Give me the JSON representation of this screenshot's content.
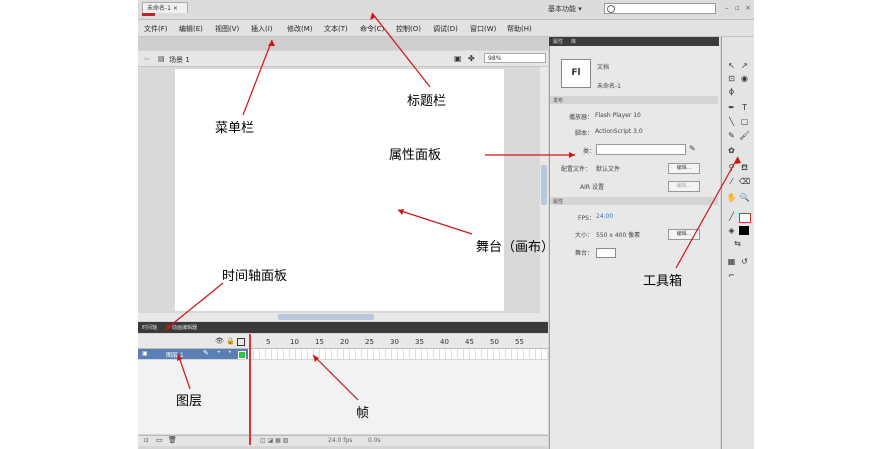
{
  "window": {
    "app_logo": "Fl",
    "workspace": "基本功能",
    "search_placeholder": ""
  },
  "menu": [
    "文件(F)",
    "编辑(E)",
    "视图(V)",
    "插入(I)",
    "修改(M)",
    "文本(T)",
    "命令(C)",
    "控制(O)",
    "调试(D)",
    "窗口(W)",
    "帮助(H)"
  ],
  "document": {
    "tab_label": "未命名-1",
    "scene_label": "场景 1",
    "zoom": "98%"
  },
  "timeline": {
    "tabs": [
      "时间轴",
      "动画编辑器"
    ],
    "frame_numbers": [
      "5",
      "10",
      "15",
      "20",
      "25",
      "30",
      "35",
      "40",
      "45",
      "50",
      "55"
    ],
    "layer_name": "图层 1",
    "footer_fps": "24.0 fps",
    "footer_time": "0.0s"
  },
  "properties": {
    "tabs": [
      "属性",
      "库"
    ],
    "doc_type": "文档",
    "doc_name": "未命名-1",
    "publish_section": "发布",
    "player_label": "播放器：",
    "player_value": "Flash Player 10",
    "script_label": "脚本：",
    "script_value": "ActionScript 3.0",
    "class_label": "类：",
    "profile_label": "配置文件：",
    "profile_value": "默认文件",
    "edit_button": "编辑...",
    "air_label": "AIR 设置",
    "props_section": "属性",
    "fps_label": "FPS：",
    "fps_value": "24.00",
    "size_label": "大小：",
    "size_value": "550 x 400 像素",
    "stage_label": "舞台："
  },
  "annotations": {
    "title_bar": "标题栏",
    "menu_bar": "菜单栏",
    "property_panel": "属性面板",
    "stage": "舞台（画布）",
    "timeline_panel": "时间轴面板",
    "toolbox": "工具箱",
    "layer": "图层",
    "frame": "帧"
  }
}
